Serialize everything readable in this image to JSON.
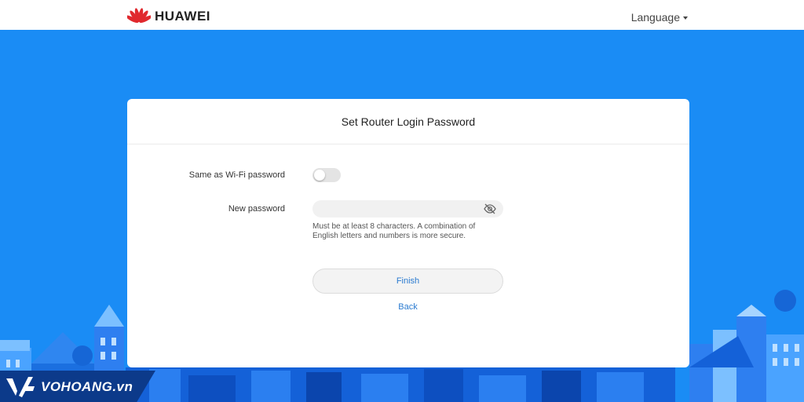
{
  "header": {
    "brand": "HUAWEI",
    "language_label": "Language"
  },
  "card": {
    "title": "Set Router Login Password",
    "same_as_wifi_label": "Same as Wi-Fi password",
    "same_as_wifi_enabled": false,
    "new_password_label": "New password",
    "new_password_value": "",
    "new_password_placeholder": "",
    "hint": "Must be at least 8 characters. A combination of English letters and numbers is more secure.",
    "finish_label": "Finish",
    "back_label": "Back"
  },
  "watermark": {
    "text": "VOHOANG.vn"
  },
  "colors": {
    "background": "#1a8cf5",
    "link": "#2b7bd0",
    "brand": "#e0292e"
  },
  "icons": {
    "brand": "huawei-petal-logo",
    "language": "caret-down-icon",
    "password_visibility": "eye-off-icon"
  }
}
